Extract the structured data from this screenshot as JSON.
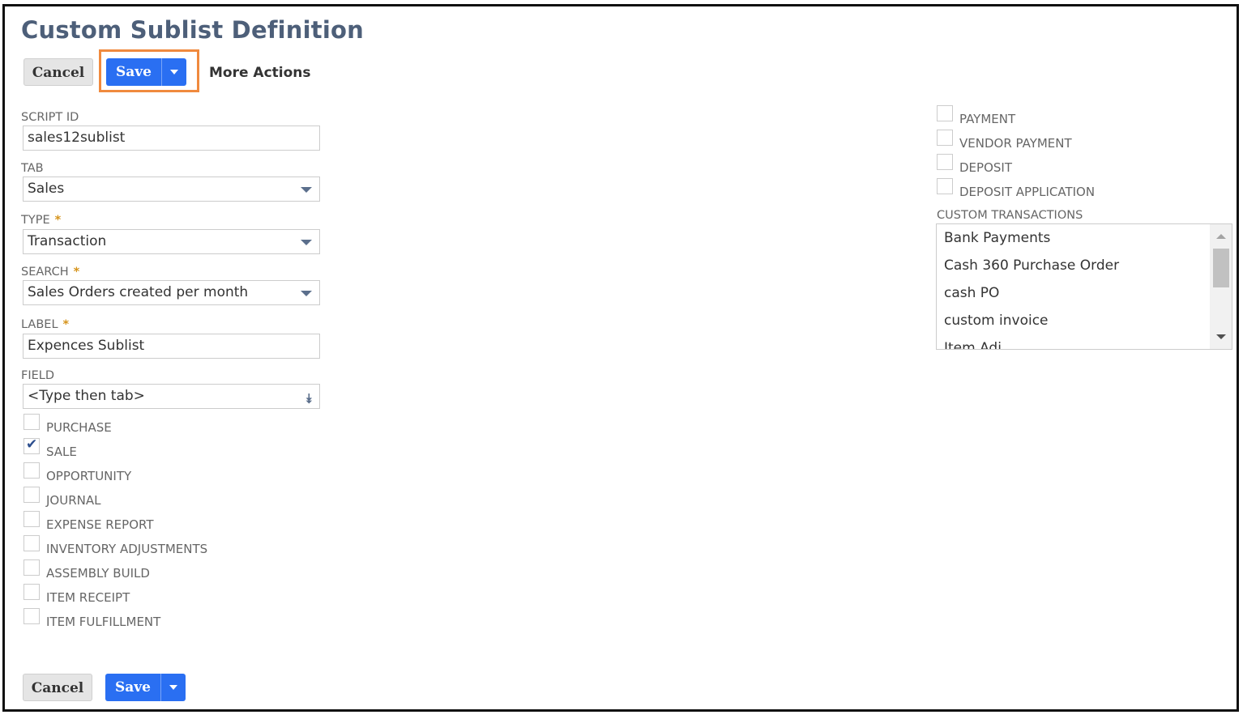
{
  "page": {
    "title": "Custom Sublist Definition"
  },
  "toolbar": {
    "cancel_label": "Cancel",
    "save_label": "Save",
    "more_actions_label": "More Actions"
  },
  "form": {
    "script_id": {
      "label": "SCRIPT ID",
      "value": "sales12sublist"
    },
    "tab": {
      "label": "TAB",
      "value": "Sales"
    },
    "type": {
      "label": "TYPE",
      "required": "*",
      "value": "Transaction"
    },
    "search": {
      "label": "SEARCH",
      "required": "*",
      "value": "Sales Orders created per month"
    },
    "label": {
      "label": "LABEL",
      "required": "*",
      "value": "Expences Sublist"
    },
    "field": {
      "label": "FIELD",
      "value": "<Type then tab>"
    }
  },
  "left_checkboxes": [
    {
      "label": "PURCHASE",
      "checked": false
    },
    {
      "label": "SALE",
      "checked": true
    },
    {
      "label": "OPPORTUNITY",
      "checked": false
    },
    {
      "label": "JOURNAL",
      "checked": false
    },
    {
      "label": "EXPENSE REPORT",
      "checked": false
    },
    {
      "label": "INVENTORY ADJUSTMENTS",
      "checked": false
    },
    {
      "label": "ASSEMBLY BUILD",
      "checked": false
    },
    {
      "label": "ITEM RECEIPT",
      "checked": false
    },
    {
      "label": "ITEM FULFILLMENT",
      "checked": false
    }
  ],
  "right_checkboxes": [
    {
      "label": "PAYMENT",
      "checked": false
    },
    {
      "label": "VENDOR PAYMENT",
      "checked": false
    },
    {
      "label": "DEPOSIT",
      "checked": false
    },
    {
      "label": "DEPOSIT APPLICATION",
      "checked": false
    }
  ],
  "custom_transactions": {
    "label": "CUSTOM TRANSACTIONS",
    "items": [
      "Bank Payments",
      "Cash 360 Purchase Order",
      "cash PO",
      "custom invoice",
      "Item Adj"
    ]
  },
  "footer": {
    "cancel_label": "Cancel",
    "save_label": "Save"
  },
  "colors": {
    "title": "#4d5f79",
    "save_button": "#2a6ff2",
    "highlight": "#f08a3e",
    "required": "#d6941c"
  }
}
